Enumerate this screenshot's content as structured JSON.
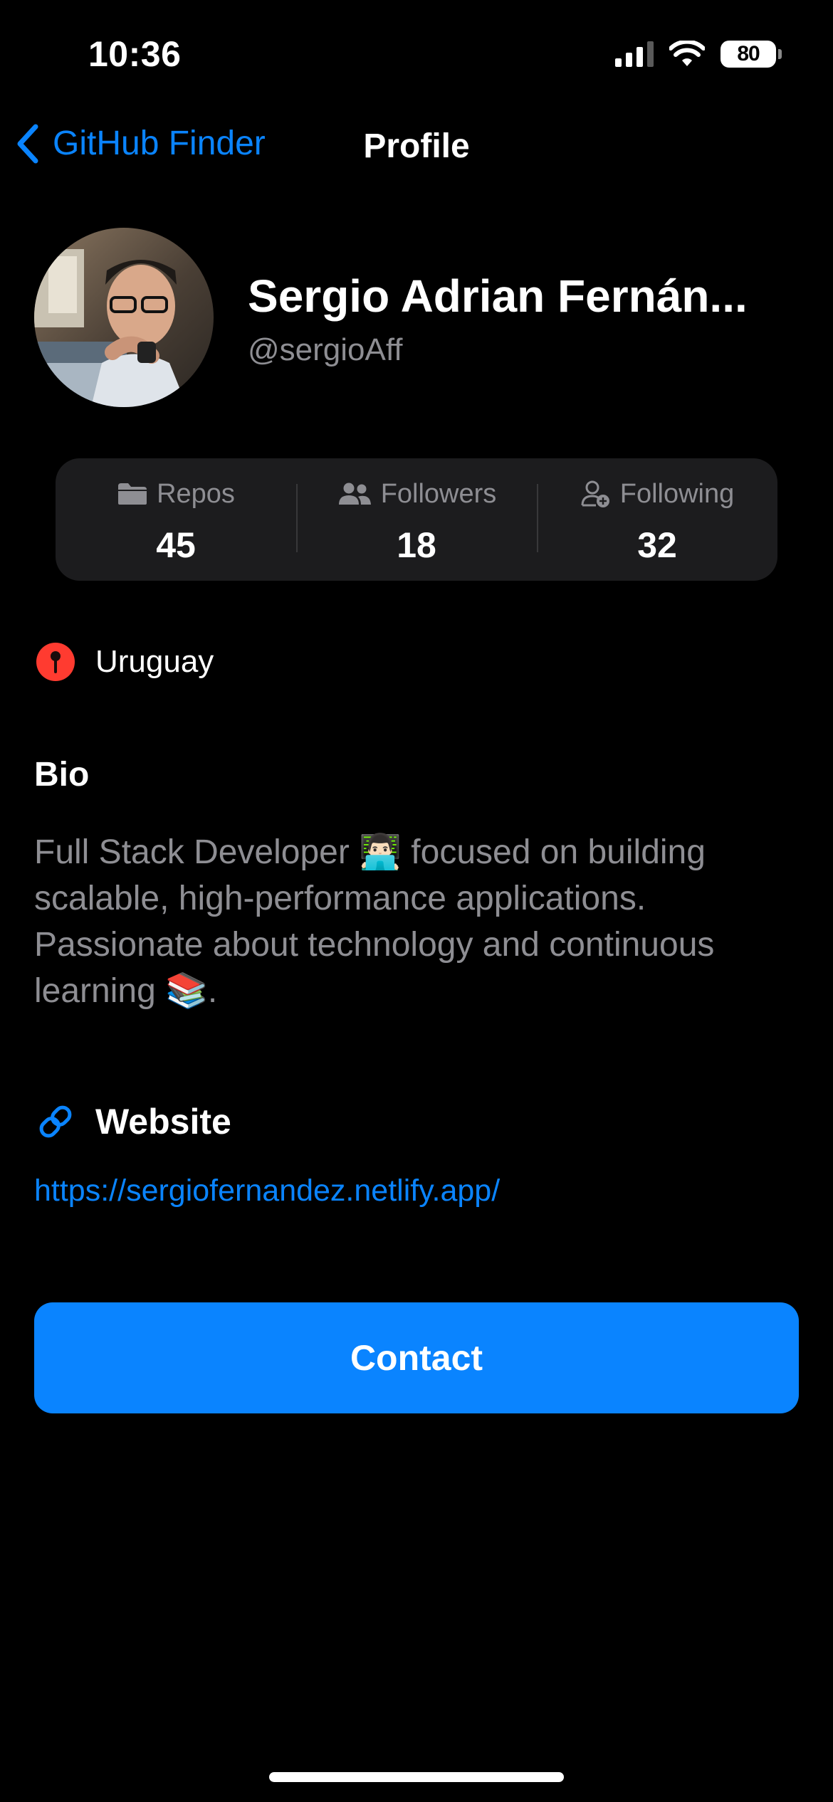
{
  "status_bar": {
    "time": "10:36",
    "battery": "80",
    "icons": [
      "cellular-signal-icon",
      "wifi-icon",
      "battery-icon"
    ]
  },
  "nav": {
    "back_label": "GitHub Finder",
    "title": "Profile"
  },
  "profile": {
    "name": "Sergio Adrian Fernán...",
    "handle": "@sergioAff"
  },
  "stats": [
    {
      "label": "Repos",
      "value": "45",
      "icon": "folder-icon"
    },
    {
      "label": "Followers",
      "value": "18",
      "icon": "people-icon"
    },
    {
      "label": "Following",
      "value": "32",
      "icon": "person-add-icon"
    }
  ],
  "location": {
    "text": "Uruguay",
    "icon": "pin-icon"
  },
  "bio": {
    "title": "Bio",
    "line1": "Full Stack Developer 👨🏻‍💻 focused on building",
    "line2": "scalable, high-performance applications.",
    "line3": "Passionate about technology and continuous",
    "line4": "learning 📚."
  },
  "website": {
    "title": "Website",
    "url": "https://sergiofernandez.netlify.app/",
    "icon": "link-icon"
  },
  "contact": {
    "label": "Contact"
  },
  "colors": {
    "background": "#000000",
    "accent": "#0a84ff",
    "card": "#1c1c1e",
    "secondary_text": "#8e8e93",
    "pin": "#ff3b30"
  }
}
